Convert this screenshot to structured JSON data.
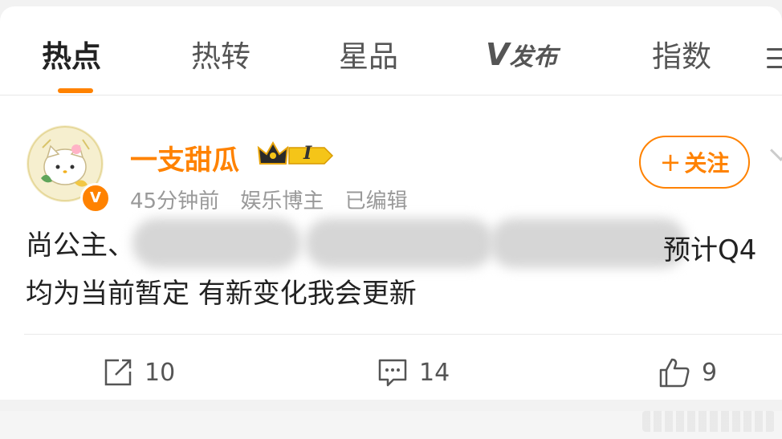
{
  "tabs": [
    {
      "label": "热点",
      "active": true
    },
    {
      "label": "热转",
      "active": false
    },
    {
      "label": "星品",
      "active": false
    },
    {
      "label": "发布",
      "logo_mark": "V",
      "active": false
    },
    {
      "label": "指数",
      "active": false
    }
  ],
  "accent_color": "#ff8200",
  "post": {
    "username": "一支甜瓜",
    "badge_level": "I",
    "time": "45分钟前",
    "category": "娱乐博主",
    "edited": "已编辑",
    "follow_label": "关注",
    "text_line1_start": "尚公主、",
    "text_line1_end": "预计Q4",
    "text_line2": "均为当前暂定 有新变化我会更新"
  },
  "actions": {
    "repost_count": "10",
    "comment_count": "14",
    "like_count": "9"
  }
}
